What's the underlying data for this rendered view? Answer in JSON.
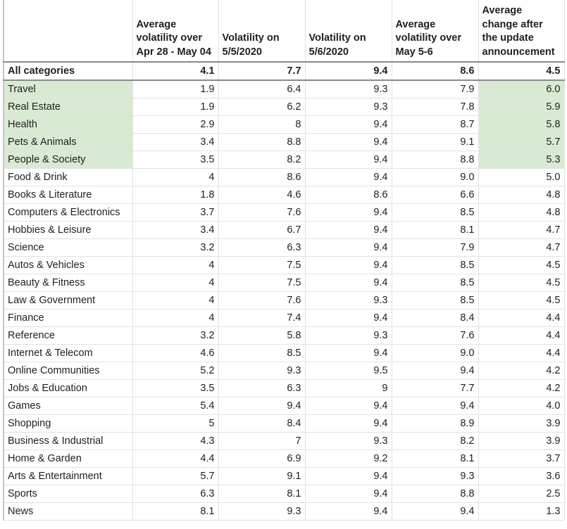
{
  "chart_data": {
    "type": "table",
    "title": "",
    "columns": [
      "",
      "Average volatility over Apr 28 - May 04",
      "Volatility on 5/5/2020",
      "Volatility on 5/6/2020",
      "Average volatility over May 5-6",
      "Average change after the update announcement"
    ],
    "total_row": {
      "category": "All categories",
      "values": [
        "4.1",
        "7.7",
        "9.4",
        "8.6",
        "4.5"
      ]
    },
    "rows": [
      {
        "category": "Travel",
        "values": [
          "1.9",
          "6.4",
          "9.3",
          "7.9",
          "6.0"
        ],
        "highlight": true
      },
      {
        "category": "Real Estate",
        "values": [
          "1.9",
          "6.2",
          "9.3",
          "7.8",
          "5.9"
        ],
        "highlight": true
      },
      {
        "category": "Health",
        "values": [
          "2.9",
          "8",
          "9.4",
          "8.7",
          "5.8"
        ],
        "highlight": true
      },
      {
        "category": "Pets & Animals",
        "values": [
          "3.4",
          "8.8",
          "9.4",
          "9.1",
          "5.7"
        ],
        "highlight": true
      },
      {
        "category": "People & Society",
        "values": [
          "3.5",
          "8.2",
          "9.4",
          "8.8",
          "5.3"
        ],
        "highlight": true
      },
      {
        "category": "Food & Drink",
        "values": [
          "4",
          "8.6",
          "9.4",
          "9.0",
          "5.0"
        ],
        "highlight": false
      },
      {
        "category": "Books & Literature",
        "values": [
          "1.8",
          "4.6",
          "8.6",
          "6.6",
          "4.8"
        ],
        "highlight": false
      },
      {
        "category": "Computers & Electronics",
        "values": [
          "3.7",
          "7.6",
          "9.4",
          "8.5",
          "4.8"
        ],
        "highlight": false
      },
      {
        "category": "Hobbies & Leisure",
        "values": [
          "3.4",
          "6.7",
          "9.4",
          "8.1",
          "4.7"
        ],
        "highlight": false
      },
      {
        "category": "Science",
        "values": [
          "3.2",
          "6.3",
          "9.4",
          "7.9",
          "4.7"
        ],
        "highlight": false
      },
      {
        "category": "Autos & Vehicles",
        "values": [
          "4",
          "7.5",
          "9.4",
          "8.5",
          "4.5"
        ],
        "highlight": false
      },
      {
        "category": "Beauty & Fitness",
        "values": [
          "4",
          "7.5",
          "9.4",
          "8.5",
          "4.5"
        ],
        "highlight": false
      },
      {
        "category": "Law & Government",
        "values": [
          "4",
          "7.6",
          "9.3",
          "8.5",
          "4.5"
        ],
        "highlight": false
      },
      {
        "category": "Finance",
        "values": [
          "4",
          "7.4",
          "9.4",
          "8.4",
          "4.4"
        ],
        "highlight": false
      },
      {
        "category": "Reference",
        "values": [
          "3.2",
          "5.8",
          "9.3",
          "7.6",
          "4.4"
        ],
        "highlight": false
      },
      {
        "category": "Internet & Telecom",
        "values": [
          "4.6",
          "8.5",
          "9.4",
          "9.0",
          "4.4"
        ],
        "highlight": false
      },
      {
        "category": "Online Communities",
        "values": [
          "5.2",
          "9.3",
          "9.5",
          "9.4",
          "4.2"
        ],
        "highlight": false
      },
      {
        "category": "Jobs & Education",
        "values": [
          "3.5",
          "6.3",
          "9",
          "7.7",
          "4.2"
        ],
        "highlight": false
      },
      {
        "category": "Games",
        "values": [
          "5.4",
          "9.4",
          "9.4",
          "9.4",
          "4.0"
        ],
        "highlight": false
      },
      {
        "category": "Shopping",
        "values": [
          "5",
          "8.4",
          "9.4",
          "8.9",
          "3.9"
        ],
        "highlight": false
      },
      {
        "category": "Business & Industrial",
        "values": [
          "4.3",
          "7",
          "9.3",
          "8.2",
          "3.9"
        ],
        "highlight": false
      },
      {
        "category": "Home & Garden",
        "values": [
          "4.4",
          "6.9",
          "9.2",
          "8.1",
          "3.7"
        ],
        "highlight": false
      },
      {
        "category": "Arts & Entertainment",
        "values": [
          "5.7",
          "9.1",
          "9.4",
          "9.3",
          "3.6"
        ],
        "highlight": false
      },
      {
        "category": "Sports",
        "values": [
          "6.3",
          "8.1",
          "9.4",
          "8.8",
          "2.5"
        ],
        "highlight": false
      },
      {
        "category": "News",
        "values": [
          "8.1",
          "9.3",
          "9.4",
          "9.4",
          "1.3"
        ],
        "highlight": false
      }
    ]
  },
  "colors": {
    "highlight": "#d9ead3",
    "grid": "#e2e2e2",
    "header_border": "#8a8a8a"
  }
}
